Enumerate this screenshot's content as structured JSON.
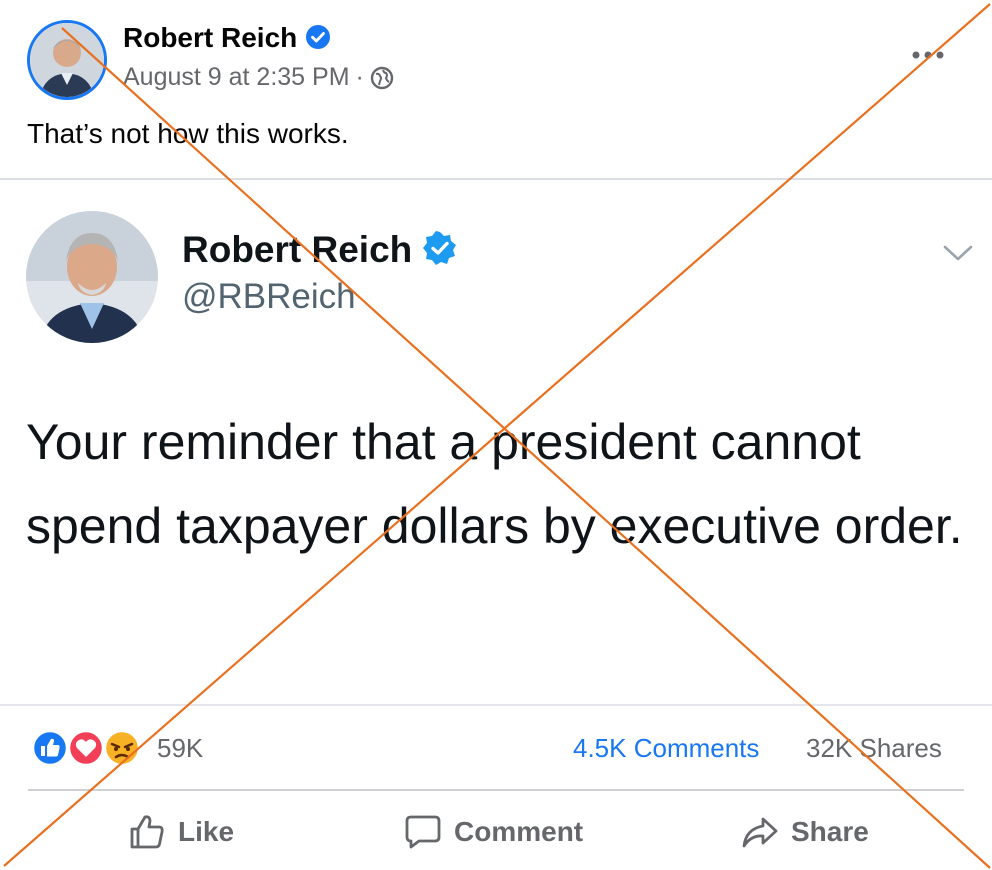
{
  "post": {
    "author": "Robert Reich",
    "date": "August 9 at 2:35 PM",
    "separator": "·",
    "caption": "That’s not how this works."
  },
  "tweet": {
    "name": "Robert Reich",
    "handle": "@RBReich",
    "text": "Your reminder that a president cannot spend taxpayer dollars by executive order."
  },
  "stats": {
    "reactions": "59K",
    "comments": "4.5K Comments",
    "shares": "32K Shares"
  },
  "actions": {
    "like": "Like",
    "comment": "Comment",
    "share": "Share"
  },
  "colors": {
    "facebook_blue": "#1877f2",
    "twitter_verified": "#1d9bf0",
    "cross_overlay": "#e8701f",
    "love": "#f33e58",
    "angry": "#f7b125"
  },
  "icons": [
    "verified-badge-icon",
    "globe-icon",
    "more-options-icon",
    "chevron-down-icon",
    "like-reaction-icon",
    "love-reaction-icon",
    "angry-reaction-icon",
    "thumbs-up-icon",
    "comment-icon",
    "share-icon"
  ]
}
